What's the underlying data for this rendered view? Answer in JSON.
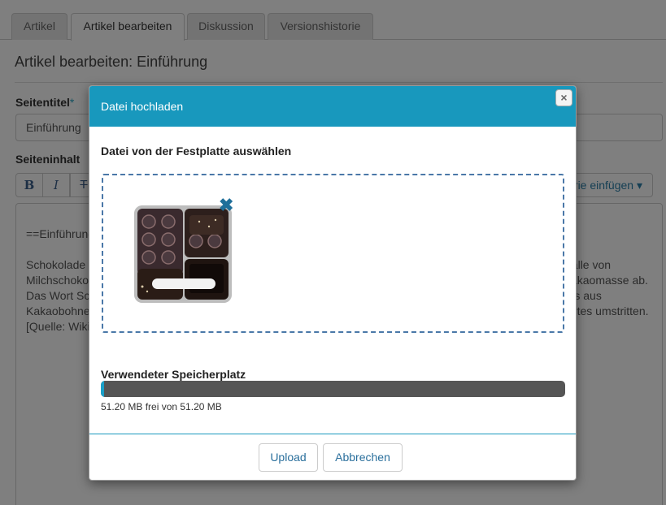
{
  "tabs": [
    {
      "label": "Artikel",
      "active": false
    },
    {
      "label": "Artikel bearbeiten",
      "active": true
    },
    {
      "label": "Diskussion",
      "active": false
    },
    {
      "label": "Versionshistorie",
      "active": false
    }
  ],
  "page": {
    "title": "Artikel bearbeiten: Einführung",
    "page_title_label": "Seitentitel",
    "required_mark": "*",
    "page_title_value": "Einführung",
    "content_label": "Seiteninhalt",
    "category_button": "Kategorie einfügen",
    "category_caret": "▾",
    "editor_lines": [
      "==Einführung==",
      "Schokolade ist ein Lebensmittel, dessen wesentliche Bestandteile Kakao, Milchpulver und Zuckerarten, im Falle von Milchschokolade und weiße Schokolade Milchbestandteile, sind. Der Name stammt vom Halbfertigprodukt Kakaomasse ab. Das Wort Schokolade kommt vermutlich aus dem Nahuatl, von dem xocóatl oder xocólatl, einem Getränk, das aus Kakaobohnen zubereitet wurde, bei den Maya und Azteken in Mexiko. Dabei ist die genaue Herkunft des Wortes umstritten. [Quelle: Wikipedia]"
    ]
  },
  "toolbar": {
    "bold": "B",
    "italic": "I",
    "strike": "T"
  },
  "modal": {
    "title": "Datei hochladen",
    "close_glyph": "×",
    "select_heading": "Datei von der Festplatte auswählen",
    "remove_glyph": "✖",
    "storage_label": "Verwendeter Speicherplatz",
    "storage_text": "51.20 MB frei von 51.20 MB",
    "storage_used_fraction": 0.006,
    "upload_button": "Upload",
    "cancel_button": "Abbrechen",
    "colors": {
      "header": "#1898bd",
      "bar": "#555555",
      "bar_fill": "#1aa0c8"
    }
  }
}
